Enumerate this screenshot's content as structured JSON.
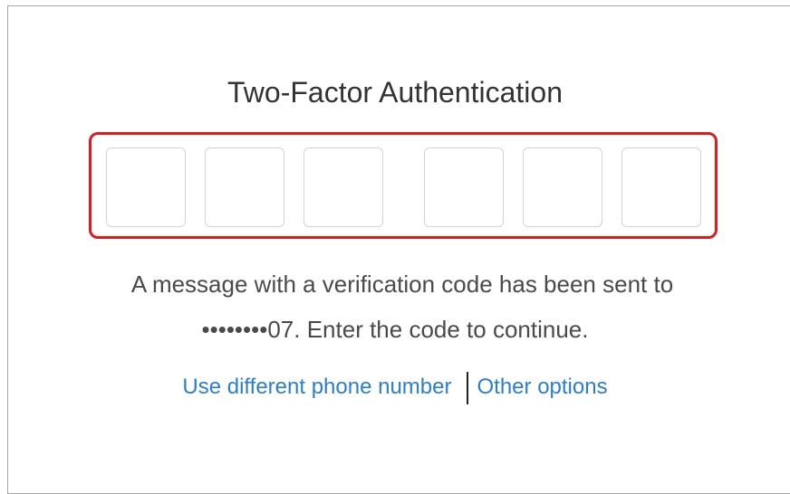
{
  "auth": {
    "title": "Two-Factor Authentication",
    "code_digits": [
      "",
      "",
      "",
      "",
      "",
      ""
    ],
    "message_line1": "A message with a verification code has been sent to",
    "message_line2": "••••••••07. Enter the code to continue."
  },
  "links": {
    "different_phone": "Use different phone number",
    "other_options": "Other options"
  },
  "colors": {
    "highlight_border": "#e01b1b",
    "link": "#2b7fd0",
    "text": "#4a4a4a"
  }
}
